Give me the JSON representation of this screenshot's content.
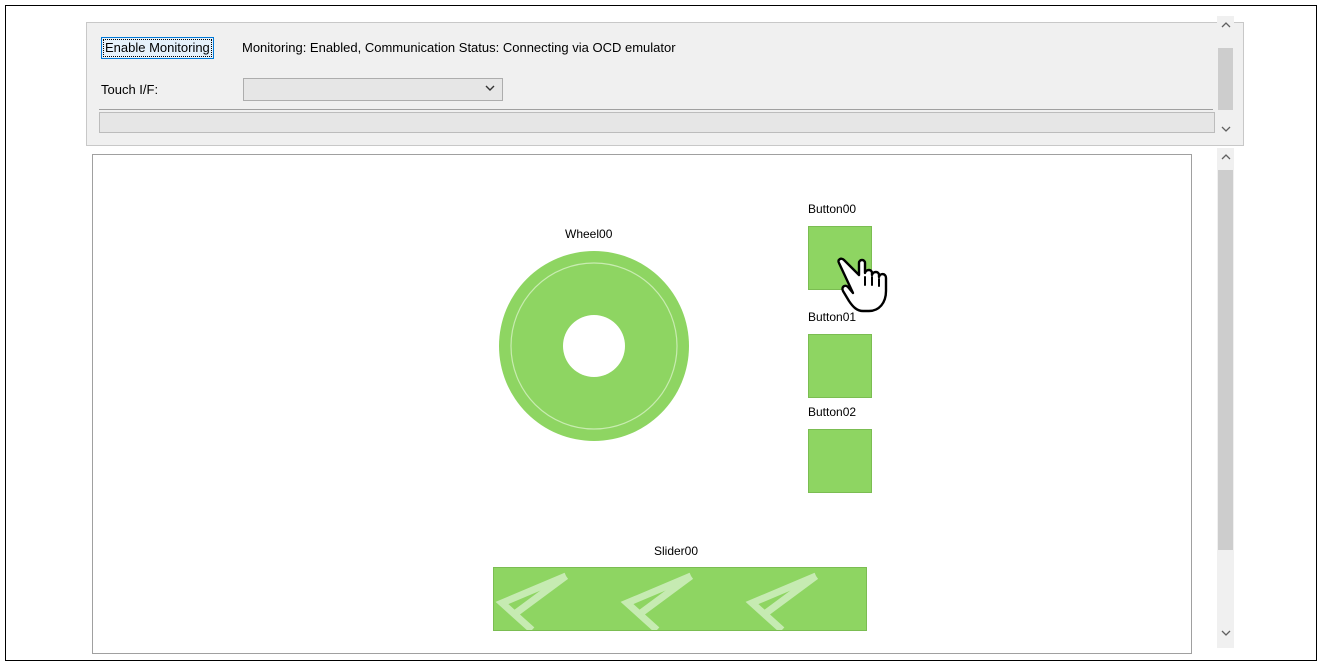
{
  "toolbar": {
    "enable_button_label": "Enable Monitoring",
    "status_text": "Monitoring: Enabled, Communication Status: Connecting via OCD emulator"
  },
  "touch_if": {
    "label": "Touch I/F:",
    "selected_value": ""
  },
  "canvas": {
    "wheel_label": "Wheel00",
    "button_labels": [
      "Button00",
      "Button01",
      "Button02"
    ],
    "slider_label": "Slider00"
  },
  "colors": {
    "element_fill": "#8ed562",
    "panel_bg": "#f0f0f0"
  },
  "icons": [
    "chevron-down-icon",
    "scroll-up-icon",
    "scroll-down-icon",
    "hand-pointer-icon"
  ]
}
